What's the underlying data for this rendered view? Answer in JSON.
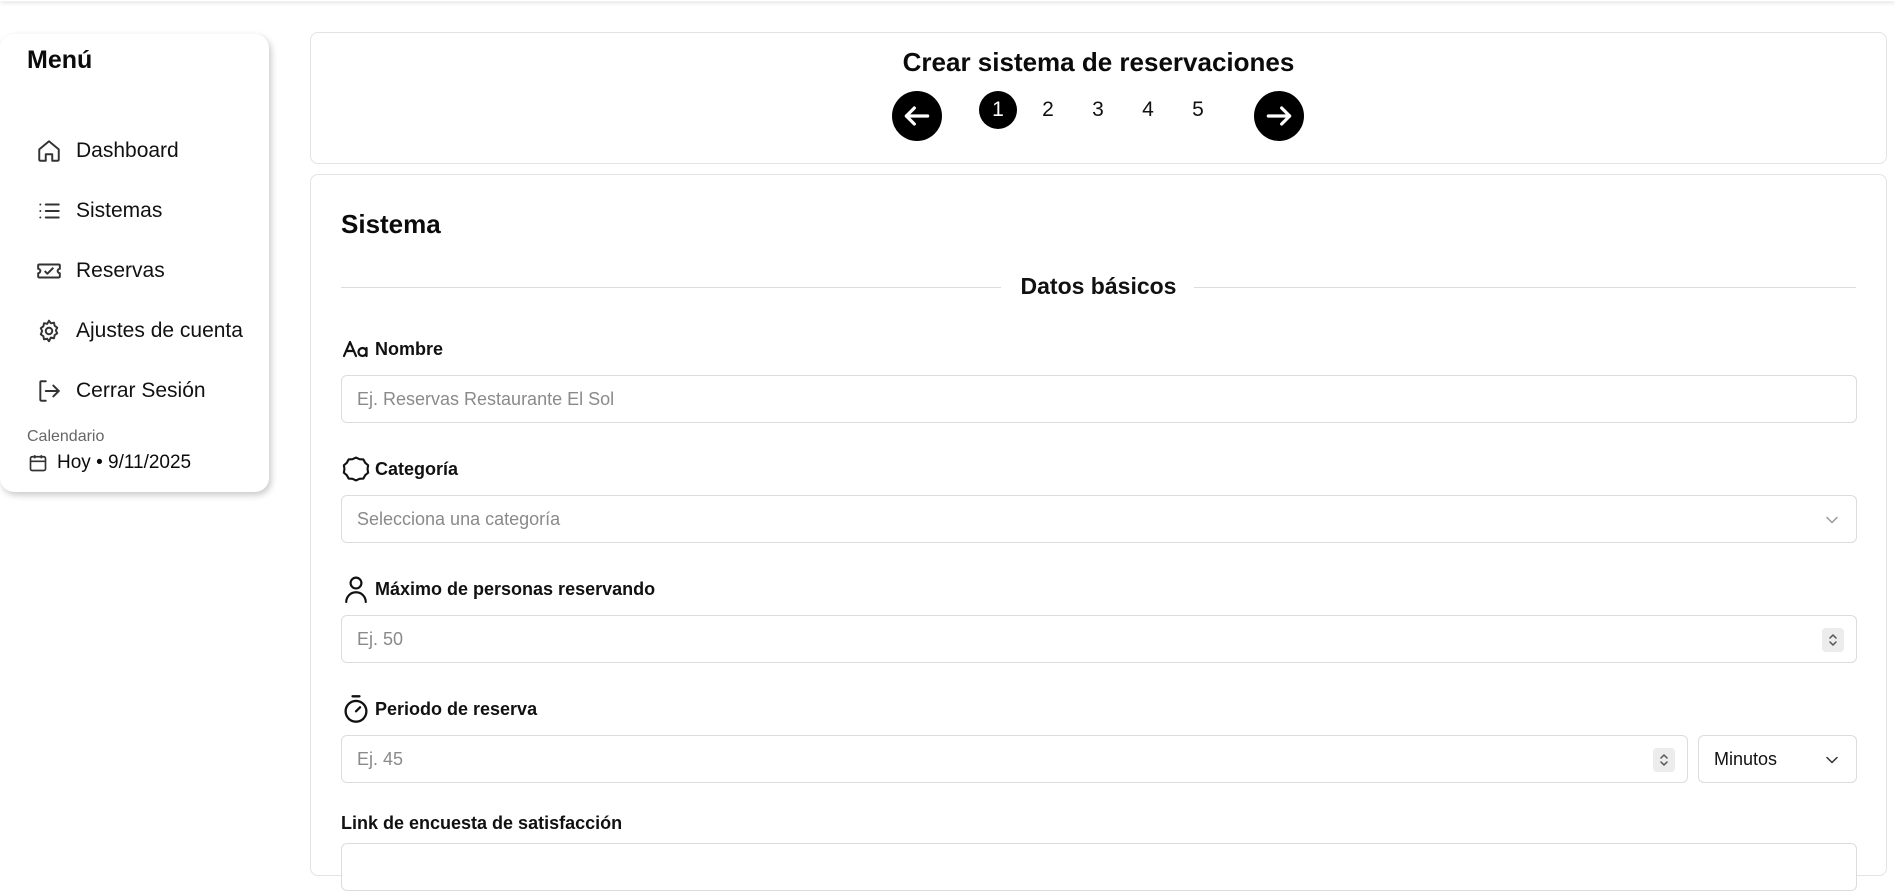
{
  "sidebar": {
    "title": "Menú",
    "items": [
      {
        "label": "Dashboard",
        "icon": "home-icon"
      },
      {
        "label": "Sistemas",
        "icon": "list-icon"
      },
      {
        "label": "Reservas",
        "icon": "ticket-icon"
      },
      {
        "label": "Ajustes de cuenta",
        "icon": "gear-icon"
      },
      {
        "label": "Cerrar Sesión",
        "icon": "logout-icon"
      }
    ],
    "calendar_label": "Calendario",
    "calendar_today": "Hoy • 9/11/2025"
  },
  "header": {
    "title": "Crear sistema de reservaciones",
    "steps": [
      "1",
      "2",
      "3",
      "4",
      "5"
    ],
    "active_step": "1"
  },
  "form": {
    "section_title": "Sistema",
    "divider_text": "Datos básicos",
    "nombre": {
      "label": "Nombre",
      "placeholder": "Ej. Reservas Restaurante El Sol"
    },
    "categoria": {
      "label": "Categoría",
      "placeholder": "Selecciona una categoría"
    },
    "max_personas": {
      "label": "Máximo de personas reservando",
      "placeholder": "Ej. 50"
    },
    "periodo": {
      "label": "Periodo de reserva",
      "placeholder": "Ej. 45",
      "unit": "Minutos"
    },
    "encuesta": {
      "label": "Link de encuesta de satisfacción"
    }
  },
  "colors": {
    "accent": "#000000",
    "border": "#dcdcdc",
    "placeholder": "#8a8a8a"
  }
}
